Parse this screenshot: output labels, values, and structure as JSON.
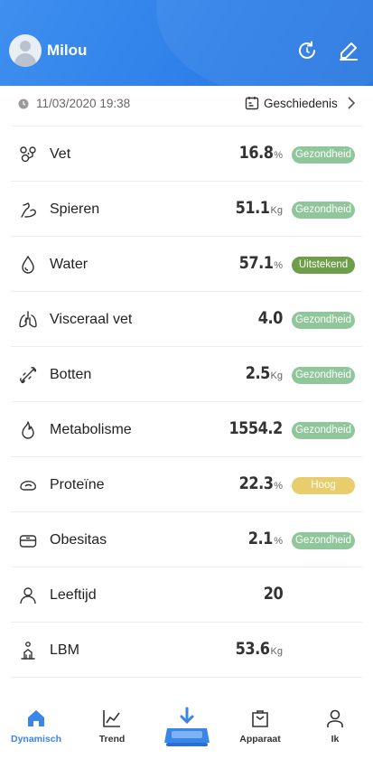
{
  "user": {
    "name": "Milou"
  },
  "measurement": {
    "datetime": "11/03/2020 19:38",
    "history_label": "Geschiedenis"
  },
  "colors": {
    "header": "#2d7fe8",
    "healthy": "#8fc79a",
    "excellent": "#6f9e4a",
    "high": "#e8cd6c",
    "active_tab": "#3a86e8"
  },
  "metrics": [
    {
      "label": "Vet",
      "value": "16.8",
      "unit": "%",
      "status": "Gezondheid",
      "status_color": "#8fc79a",
      "icon": "fat-icon"
    },
    {
      "label": "Spieren",
      "value": "51.1",
      "unit": "Kg",
      "status": "Gezondheid",
      "status_color": "#8fc79a",
      "icon": "muscle-icon"
    },
    {
      "label": "Water",
      "value": "57.1",
      "unit": "%",
      "status": "Uitstekend",
      "status_color": "#6f9e4a",
      "icon": "water-drop-icon"
    },
    {
      "label": "Visceraal vet",
      "value": "4.0",
      "unit": "",
      "status": "Gezondheid",
      "status_color": "#8fc79a",
      "icon": "lungs-icon"
    },
    {
      "label": "Botten",
      "value": "2.5",
      "unit": "Kg",
      "status": "Gezondheid",
      "status_color": "#8fc79a",
      "icon": "bone-icon"
    },
    {
      "label": "Metabolisme",
      "value": "1554.2",
      "unit": "",
      "status": "Gezondheid",
      "status_color": "#8fc79a",
      "icon": "flame-icon"
    },
    {
      "label": "Proteïne",
      "value": "22.3",
      "unit": "%",
      "status": "Hoog",
      "status_color": "#e8cd6c",
      "icon": "protein-icon"
    },
    {
      "label": "Obesitas",
      "value": "2.1",
      "unit": "%",
      "status": "Gezondheid",
      "status_color": "#8fc79a",
      "icon": "scale-body-icon"
    },
    {
      "label": "Leeftijd",
      "value": "20",
      "unit": "",
      "status": "",
      "status_color": "",
      "icon": "person-icon"
    },
    {
      "label": "LBM",
      "value": "53.6",
      "unit": "Kg",
      "status": "",
      "status_color": "",
      "icon": "lean-body-icon"
    }
  ],
  "tabs": [
    {
      "label": "Dynamisch",
      "icon": "home-icon",
      "active": true
    },
    {
      "label": "Trend",
      "icon": "trend-chart-icon",
      "active": false
    },
    {
      "label": "",
      "icon": "scale-download-icon",
      "active": false
    },
    {
      "label": "Apparaat",
      "icon": "device-bag-icon",
      "active": false
    },
    {
      "label": "Ik",
      "icon": "profile-icon",
      "active": false
    }
  ]
}
